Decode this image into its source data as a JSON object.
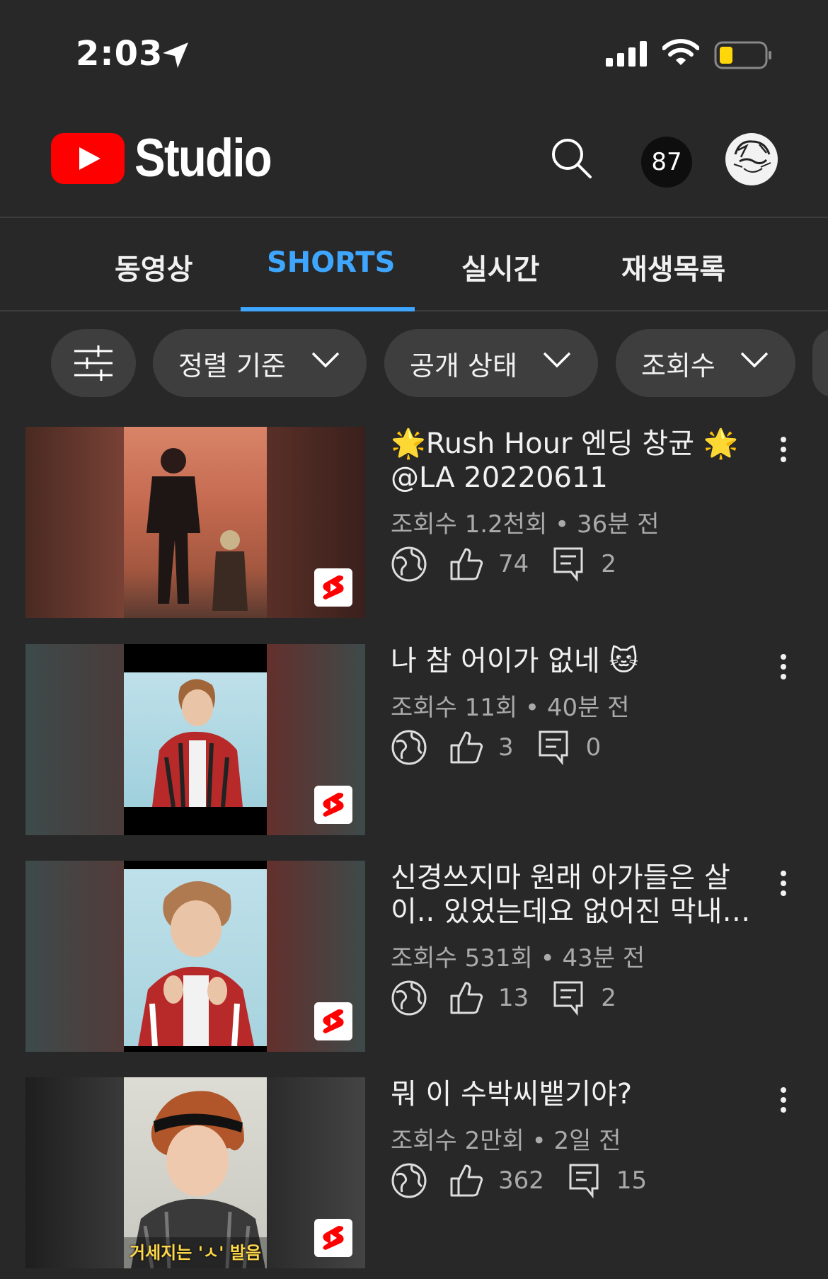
{
  "status_bar": {
    "time": "2:03"
  },
  "header": {
    "app_name": "Studio",
    "notification_count": "87"
  },
  "tabs": [
    {
      "label": "동영상"
    },
    {
      "label": "SHORTS",
      "active": true
    },
    {
      "label": "실시간"
    },
    {
      "label": "재생목록"
    }
  ],
  "filters": [
    {
      "label": "정렬 기준"
    },
    {
      "label": "공개 상태"
    },
    {
      "label": "조회수"
    }
  ],
  "videos": [
    {
      "title": "🌟Rush Hour 엔딩 창균 🌟@LA 20220611",
      "views": "조회수 1.2천회",
      "age": "36분 전",
      "likes": "74",
      "comments": "2",
      "visibility_icon": "globe-icon"
    },
    {
      "title": "나 참 어이가 없네 🐱",
      "views": "조회수 11회",
      "age": "40분 전",
      "likes": "3",
      "comments": "0",
      "visibility_icon": "globe-icon"
    },
    {
      "title": "신경쓰지마 원래 아가들은 살이.. 있었는데요 없어진 막내…",
      "views": "조회수 531회",
      "age": "43분 전",
      "likes": "13",
      "comments": "2",
      "visibility_icon": "globe-icon"
    },
    {
      "title": "뭐 이 수박씨뱉기야?",
      "views": "조회수 2만회",
      "age": "2일 전",
      "likes": "362",
      "comments": "15",
      "visibility_icon": "globe-icon"
    }
  ],
  "thumbnail_caption_4": "거세지는 'ㅅ' 발음",
  "colors": {
    "accent": "#3ea6ff",
    "background": "#282828",
    "youtube_red": "#ff0000"
  }
}
